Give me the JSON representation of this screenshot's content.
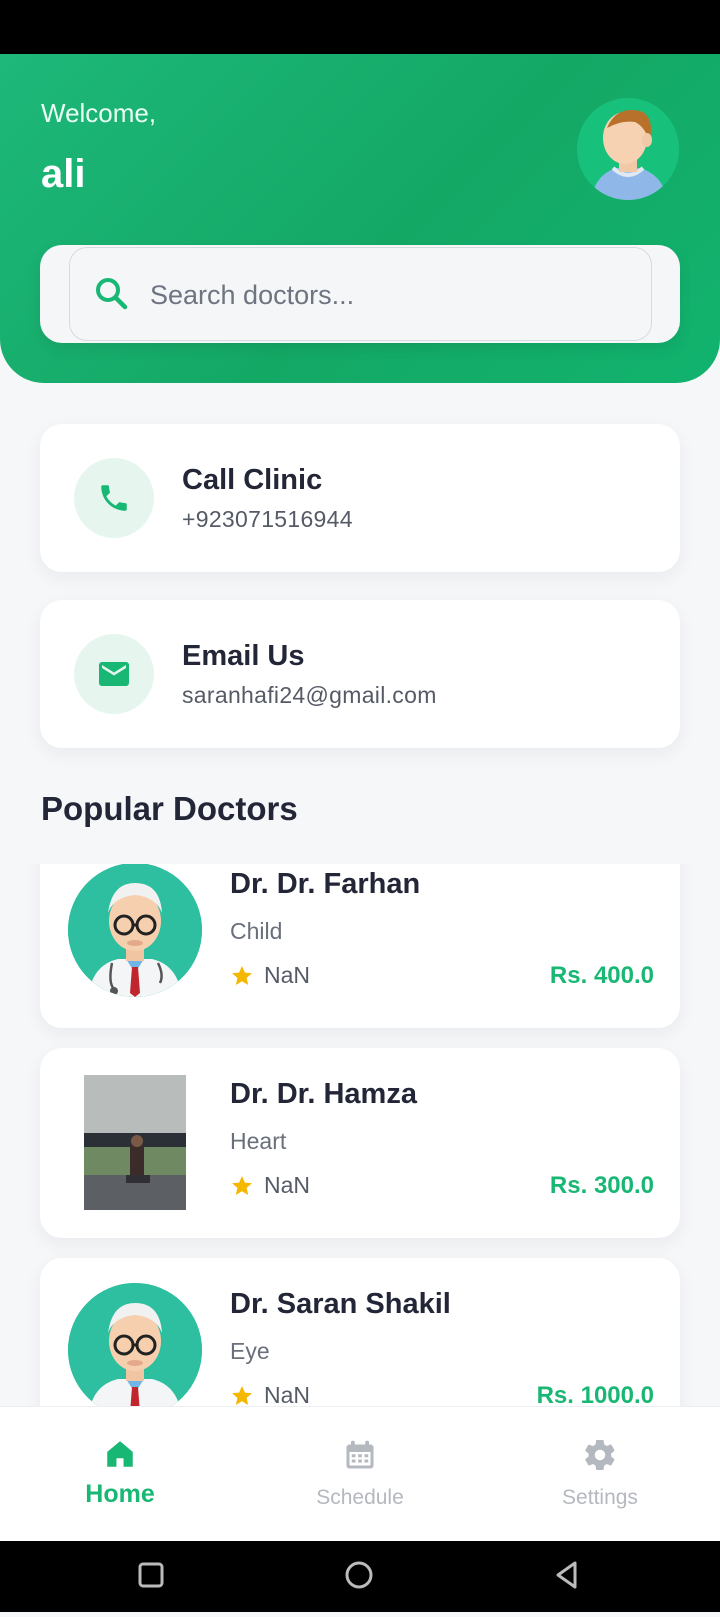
{
  "header": {
    "welcome_label": "Welcome,",
    "username": "ali",
    "search_placeholder": "Search doctors..."
  },
  "contacts": [
    {
      "title": "Call Clinic",
      "detail": "+923071516944",
      "icon": "phone-icon"
    },
    {
      "title": "Email Us",
      "detail": "saranhafi24@gmail.com",
      "icon": "mail-icon"
    }
  ],
  "section_title": "Popular Doctors",
  "doctors": [
    {
      "name": "Dr. Dr. Farhan",
      "specialty": "Child",
      "rating": "NaN",
      "price": "Rs. 400.0",
      "image": "doctor-illustration"
    },
    {
      "name": "Dr. Dr. Hamza",
      "specialty": "Heart",
      "rating": "NaN",
      "price": "Rs. 300.0",
      "image": "doctor-photo"
    },
    {
      "name": "Dr. Saran Shakil",
      "specialty": "Eye",
      "rating": "NaN",
      "price": "Rs. 1000.0",
      "image": "doctor-illustration"
    }
  ],
  "nav": [
    {
      "label": "Home",
      "icon": "home-icon",
      "active": true
    },
    {
      "label": "Schedule",
      "icon": "calendar-icon",
      "active": false
    },
    {
      "label": "Settings",
      "icon": "gear-icon",
      "active": false
    }
  ],
  "colors": {
    "accent": "#19b774",
    "header_gradient_start": "#1db87a",
    "star": "#f5b800"
  }
}
